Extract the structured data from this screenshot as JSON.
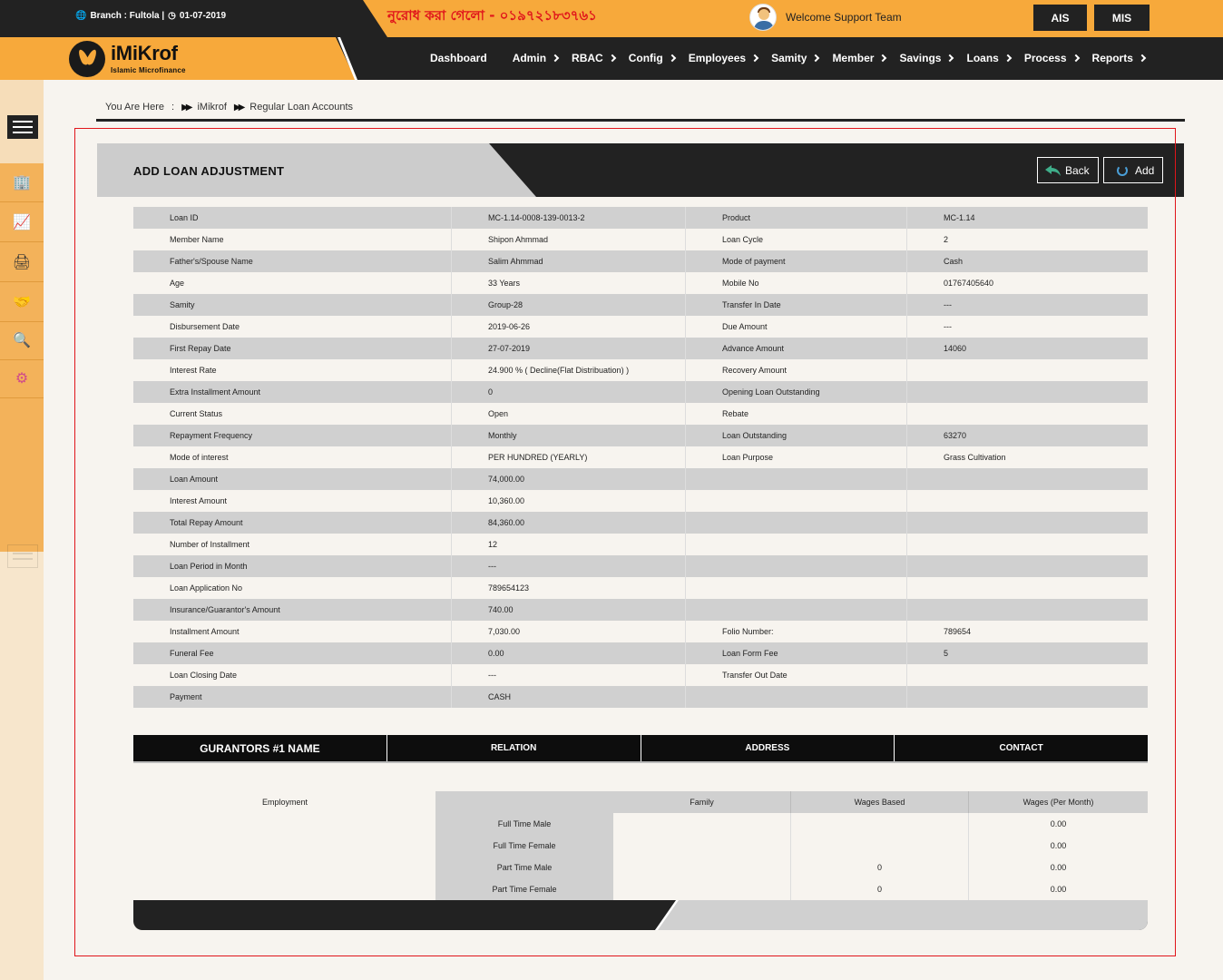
{
  "header": {
    "branch": "Branch : Fultola |",
    "date": "01-07-2019",
    "notice": "নুরোধ করা গেলো - ০১৯৭২১৮৩৭৬১",
    "welcome": "Welcome Support Team",
    "ais": "AIS",
    "mis": "MIS"
  },
  "logo": {
    "name": "iMiKrof",
    "subtitle": "Islamic Microfinance"
  },
  "nav": [
    "Dashboard",
    "Admin",
    "RBAC",
    "Config",
    "Employees",
    "Samity",
    "Member",
    "Savings",
    "Loans",
    "Process",
    "Reports"
  ],
  "breadcrumb": {
    "label": "You Are Here",
    "colon": ":",
    "items": [
      "iMikrof",
      "Regular Loan Accounts"
    ]
  },
  "panel": {
    "title": "ADD LOAN ADJUSTMENT",
    "back": "Back",
    "add": "Add"
  },
  "details": [
    [
      "Loan ID",
      "MC-1.14-0008-139-0013-2",
      "Product",
      "MC-1.14"
    ],
    [
      "Member Name",
      "Shipon Ahmmad",
      "Loan Cycle",
      "2"
    ],
    [
      "Father's/Spouse Name",
      "Salim Ahmmad",
      "Mode of payment",
      "Cash"
    ],
    [
      "Age",
      "33 Years",
      "Mobile No",
      "01767405640"
    ],
    [
      "Samity",
      "Group-28",
      "Transfer In Date",
      "---"
    ],
    [
      "Disbursement Date",
      "2019-06-26",
      "Due Amount",
      "---"
    ],
    [
      "First Repay Date",
      "27-07-2019",
      "Advance Amount",
      "14060"
    ],
    [
      "Interest Rate",
      "24.900 % ( Decline(Flat Distribuation) )",
      "Recovery Amount",
      ""
    ],
    [
      "Extra Installment Amount",
      "0",
      "Opening Loan Outstanding",
      ""
    ],
    [
      "Current Status",
      "Open",
      "Rebate",
      ""
    ],
    [
      "Repayment Frequency",
      "Monthly",
      "Loan Outstanding",
      "63270"
    ],
    [
      "Mode of interest",
      "PER HUNDRED (YEARLY)",
      "Loan Purpose",
      "Grass Cultivation"
    ],
    [
      "Loan Amount",
      "74,000.00",
      "",
      ""
    ],
    [
      "Interest Amount",
      "10,360.00",
      "",
      ""
    ],
    [
      "Total Repay Amount",
      "84,360.00",
      "",
      ""
    ],
    [
      "Number of Installment",
      "12",
      "",
      ""
    ],
    [
      "Loan Period in Month",
      "---",
      "",
      ""
    ],
    [
      "Loan Application No",
      "789654123",
      "",
      ""
    ],
    [
      "Insurance/Guarantor's Amount",
      "740.00",
      "",
      ""
    ],
    [
      "Installment Amount",
      "7,030.00",
      "Folio Number:",
      "789654"
    ],
    [
      "Funeral Fee",
      "0.00",
      "Loan Form Fee",
      "5"
    ],
    [
      "Loan Closing Date",
      "---",
      "Transfer Out Date",
      ""
    ],
    [
      "Payment",
      "CASH",
      "",
      ""
    ]
  ],
  "guarantors": [
    "GURANTORS #1 NAME",
    "RELATION",
    "ADDRESS",
    "CONTACT"
  ],
  "employment": {
    "label": "Employment",
    "headers": [
      "",
      "Family",
      "Wages Based",
      "Wages (Per Month)"
    ],
    "rows": [
      [
        "Full Time Male",
        "",
        "",
        "0.00"
      ],
      [
        "Full Time Female",
        "",
        "",
        "0.00"
      ],
      [
        "Part Time Male",
        "",
        "0",
        "0.00"
      ],
      [
        "Part Time Female",
        "",
        "0",
        "0.00"
      ]
    ]
  }
}
